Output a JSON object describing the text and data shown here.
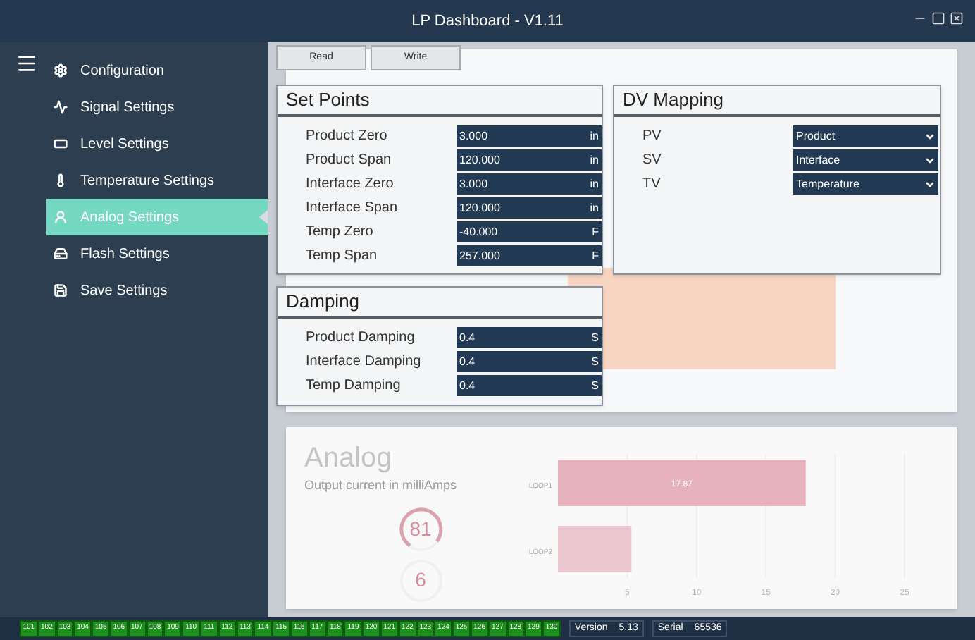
{
  "window": {
    "title": "LP Dashboard - V1.11"
  },
  "sidebar": {
    "items": [
      {
        "label": "Configuration",
        "selected": false
      },
      {
        "label": "Signal Settings",
        "selected": false
      },
      {
        "label": "Level Settings",
        "selected": false
      },
      {
        "label": "Temperature Settings",
        "selected": false
      },
      {
        "label": "Analog Settings",
        "selected": true
      },
      {
        "label": "Flash Settings",
        "selected": false
      },
      {
        "label": "Save Settings",
        "selected": false
      }
    ]
  },
  "toolbar": {
    "buttons": [
      "Read",
      "Write"
    ]
  },
  "set_points": {
    "title": "Set Points",
    "rows": [
      {
        "label": "Product Zero",
        "value": "3.000",
        "unit": "in"
      },
      {
        "label": "Product Span",
        "value": "120.000",
        "unit": "in"
      },
      {
        "label": "Interface Zero",
        "value": "3.000",
        "unit": "in"
      },
      {
        "label": "Interface Span",
        "value": "120.000",
        "unit": "in"
      },
      {
        "label": "Temp Zero",
        "value": "-40.000",
        "unit": "F"
      },
      {
        "label": "Temp Span",
        "value": "257.000",
        "unit": "F"
      }
    ]
  },
  "damping": {
    "title": "Damping",
    "rows": [
      {
        "label": "Product Damping",
        "value": "0.4",
        "unit": "S"
      },
      {
        "label": "Interface Damping",
        "value": "0.4",
        "unit": "S"
      },
      {
        "label": "Temp Damping",
        "value": "0.4",
        "unit": "S"
      }
    ]
  },
  "dv_mapping": {
    "title": "DV Mapping",
    "rows": [
      {
        "label": "PV",
        "value": "Product"
      },
      {
        "label": "SV",
        "value": "Interface"
      },
      {
        "label": "TV",
        "value": "Temperature"
      }
    ]
  },
  "analog": {
    "title": "Analog",
    "subtitle": "Output current in milliAmps",
    "gauges": [
      "81",
      "6"
    ],
    "chart_data": {
      "type": "bar",
      "orientation": "horizontal",
      "categories": [
        "LOOP1",
        "LOOP2"
      ],
      "values": [
        17.87,
        5.3
      ],
      "grid": true,
      "xlim": [
        0,
        25
      ],
      "xticks": [
        5,
        10,
        15,
        20,
        25
      ],
      "value_labels": [
        "17.87",
        null
      ]
    }
  },
  "status_bar": {
    "channels": [
      "101",
      "102",
      "103",
      "104",
      "105",
      "106",
      "107",
      "108",
      "109",
      "110",
      "111",
      "112",
      "113",
      "114",
      "115",
      "116",
      "117",
      "118",
      "119",
      "120",
      "121",
      "122",
      "123",
      "124",
      "125",
      "126",
      "127",
      "128",
      "129",
      "130"
    ],
    "version_label": "Version",
    "version": "5.13",
    "serial_label": "Serial",
    "serial": "65536"
  }
}
